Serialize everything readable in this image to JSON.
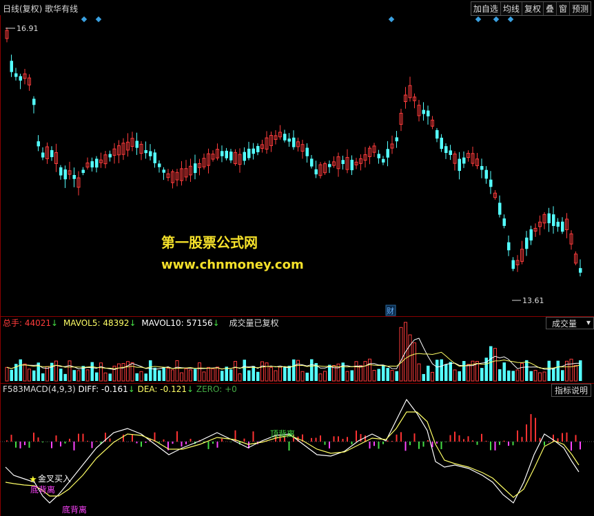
{
  "header": {
    "title": "日线(复权)  歌华有线",
    "buttons": [
      "加自选",
      "均线",
      "复权",
      "叠",
      "窗",
      "预测"
    ]
  },
  "price_chart": {
    "high_label": "16.91",
    "low_label": "13.61",
    "event_label": "财"
  },
  "watermark": {
    "line1": "第一股票公式网",
    "line2": "www.chnmoney.com"
  },
  "volume": {
    "total_label": "总手: 44021",
    "mavol5_label": "MAVOL5: 48392",
    "mavol10_label": "MAVOL10: 57156",
    "note": "成交量已复权",
    "selector": "成交量"
  },
  "macd": {
    "name_label": "F583MACD(4,9,3)",
    "diff_label": "DIFF: -0.161",
    "dea_label": "DEA: -0.121",
    "zero_label": "ZERO: +0",
    "indicator_button": "指标说明",
    "annotations": {
      "golden_cross": "金叉买入",
      "bottom_div_1": "底背离",
      "bottom_div_2": "底背离",
      "top_div": "顶背离"
    }
  },
  "colors": {
    "up": "#ff3c3c",
    "down": "#54ffff",
    "diff": "#ffffff",
    "dea": "#ffff66",
    "hist_pos": "#ff3232",
    "hist_neg_green": "#44dd44",
    "hist_neg_mag": "#ff44ff"
  }
}
